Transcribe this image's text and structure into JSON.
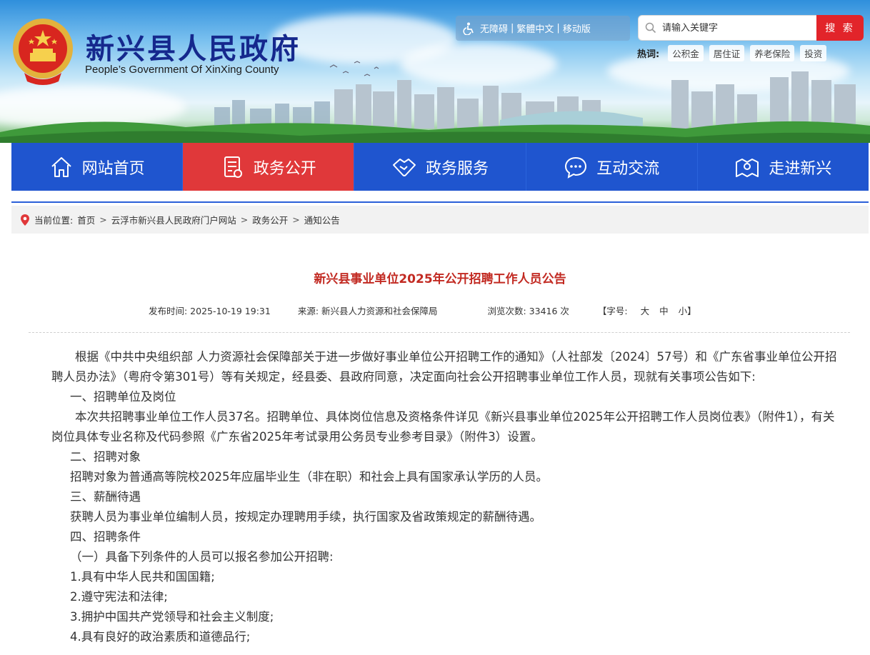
{
  "header": {
    "title": "新兴县人民政府",
    "subtitle": "People’s Government Of XinXing County",
    "util": {
      "accessible": "无障碍",
      "traditional": "繁體中文",
      "mobile": "移动版"
    },
    "search": {
      "placeholder": "请输入关键字",
      "button": "搜 索"
    },
    "hot": {
      "label": "热词:",
      "tags": [
        "公积金",
        "居住证",
        "养老保险",
        "投资"
      ]
    }
  },
  "nav": {
    "items": [
      {
        "label": "网站首页",
        "icon": "home-icon"
      },
      {
        "label": "政务公开",
        "icon": "document-icon"
      },
      {
        "label": "政务服务",
        "icon": "handshake-icon"
      },
      {
        "label": "互动交流",
        "icon": "chat-icon"
      },
      {
        "label": "走进新兴",
        "icon": "map-pin-icon"
      }
    ],
    "active_index": 1
  },
  "breadcrumb": {
    "label": "当前位置:",
    "items": [
      "首页",
      "云浮市新兴县人民政府门户网站",
      "政务公开",
      "通知公告"
    ]
  },
  "article": {
    "title": "新兴县事业单位2025年公开招聘工作人员公告",
    "meta": {
      "publish": "发布时间:  2025-10-19 19:31",
      "source": "来源:  新兴县人力资源和社会保障局",
      "views": "浏览次数:  33416 次",
      "font_label": "【字号:",
      "font_large": "大",
      "font_medium": "中",
      "font_small": "小】"
    },
    "paragraphs": [
      "根据《中共中央组织部 人力资源社会保障部关于进一步做好事业单位公开招聘工作的通知》（人社部发〔2024〕57号）和《广东省事业单位公开招聘人员办法》（粤府令第301号）等有关规定，经县委、县政府同意，决定面向社会公开招聘事业单位工作人员，现就有关事项公告如下:",
      "一、招聘单位及岗位",
      "本次共招聘事业单位工作人员37名。招聘单位、具体岗位信息及资格条件详见《新兴县事业单位2025年公开招聘工作人员岗位表》（附件1），有关岗位具体专业名称及代码参照《广东省2025年考试录用公务员专业参考目录》（附件3）设置。",
      "二、招聘对象",
      "招聘对象为普通高等院校2025年应届毕业生（非在职）和社会上具有国家承认学历的人员。",
      "三、薪酬待遇",
      "获聘人员为事业单位编制人员，按规定办理聘用手续，执行国家及省政策规定的薪酬待遇。",
      "四、招聘条件",
      "（一）具备下列条件的人员可以报名参加公开招聘:",
      "1.具有中华人民共和国国籍;",
      "2.遵守宪法和法律;",
      "3.拥护中国共产党领导和社会主义制度;",
      "4.具有良好的政治素质和道德品行;"
    ]
  }
}
